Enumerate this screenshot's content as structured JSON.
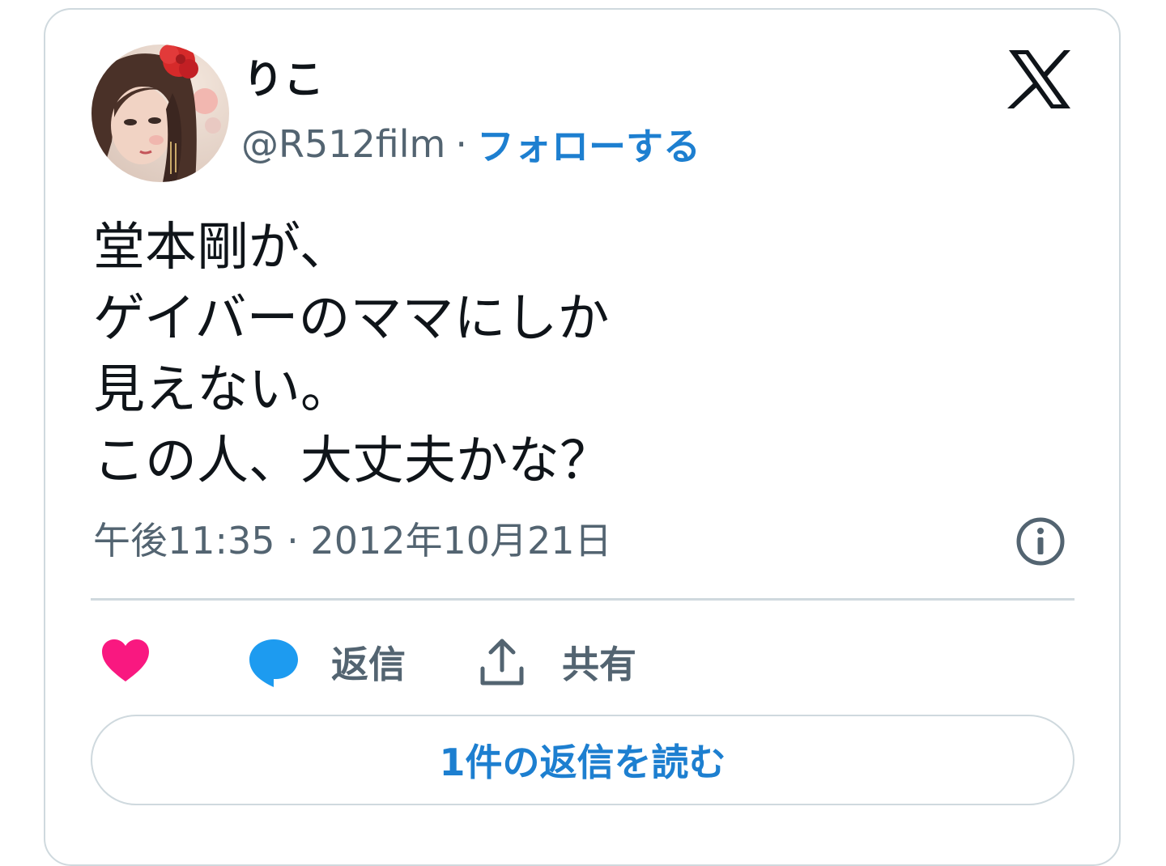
{
  "user": {
    "display_name": "りこ",
    "handle": "@R512film",
    "separator": "·",
    "follow_label": "フォローする"
  },
  "tweet": {
    "lines": [
      "堂本剛が、",
      "ゲイバーのママにしか",
      "見えない。",
      "この人、大丈夫かな？"
    ],
    "timestamp": "午後11:35 · 2012年10月21日"
  },
  "actions": {
    "reply_label": "返信",
    "share_label": "共有",
    "read_replies_label": "1件の返信を読む"
  },
  "icons": {
    "logo": "x-logo-icon",
    "info": "info-icon",
    "like": "heart-icon",
    "reply": "speech-bubble-icon",
    "share": "share-upload-icon"
  },
  "colors": {
    "link_blue": "#1d7fd0",
    "heart_pink": "#f91880",
    "reply_blue": "#1d9bf0",
    "text_primary": "#0f1419",
    "text_secondary": "#536471",
    "border": "#cfd9de"
  }
}
